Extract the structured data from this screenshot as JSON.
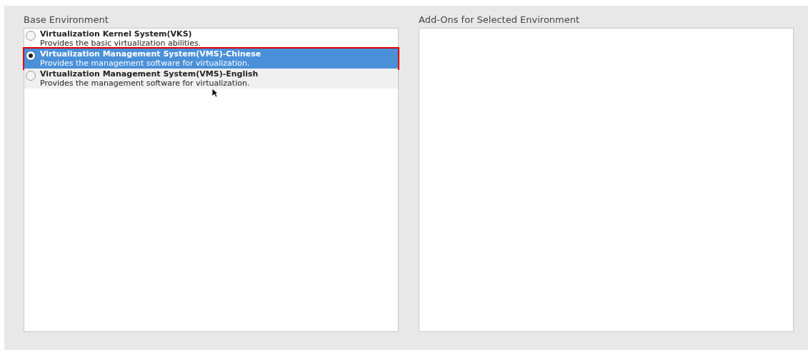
{
  "base_environment": {
    "heading": "Base Environment",
    "items": [
      {
        "title": "Virtualization Kernel System(VKS)",
        "description": "Provides the basic virtualization abilities.",
        "selected": false,
        "hovered": false,
        "outlined": false
      },
      {
        "title": "Virtualization Management System(VMS)-Chinese",
        "description": "Provides the management software for virtualization.",
        "selected": true,
        "hovered": false,
        "outlined": true
      },
      {
        "title": "Virtualization Management System(VMS)-English",
        "description": "Provides the management software for virtualization.",
        "selected": false,
        "hovered": true,
        "outlined": false
      }
    ]
  },
  "addons": {
    "heading": "Add-Ons for Selected Environment"
  }
}
